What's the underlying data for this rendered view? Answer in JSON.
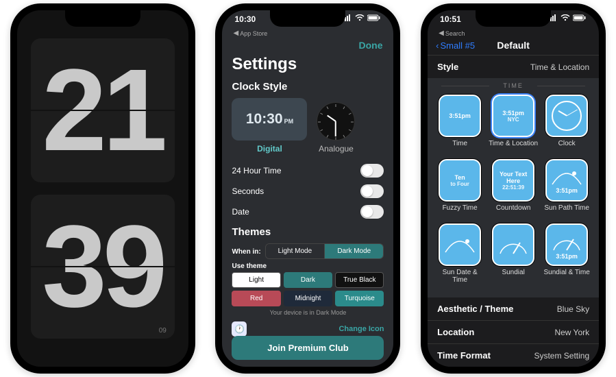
{
  "phone1": {
    "hours": "21",
    "minutes": "39",
    "date": "09"
  },
  "phone2": {
    "status_time": "10:30",
    "breadcrumb": "App Store",
    "done": "Done",
    "title": "Settings",
    "section_clock": "Clock Style",
    "digital": {
      "time": "10:30",
      "suffix": "PM",
      "label": "Digital"
    },
    "analogue_label": "Analogue",
    "toggles": [
      {
        "label": "24 Hour Time",
        "on": false
      },
      {
        "label": "Seconds",
        "on": false
      },
      {
        "label": "Date",
        "on": false
      }
    ],
    "section_themes": "Themes",
    "when_in_label": "When in:",
    "when_in": [
      "Light Mode",
      "Dark Mode"
    ],
    "when_in_active": 1,
    "use_theme_label": "Use theme",
    "themes": [
      "Light",
      "Dark",
      "True Black",
      "Red",
      "Midnight",
      "Turquoise"
    ],
    "theme_hint": "Your device is in Dark Mode",
    "change_icon": "Change Icon",
    "premium": "Join Premium Club"
  },
  "phone3": {
    "status_time": "10:51",
    "breadcrumb": "Search",
    "back": "Small #5",
    "nav_title": "Default",
    "style_label": "Style",
    "style_value": "Time & Location",
    "time_header": "TIME",
    "widgets": [
      {
        "label": "Time",
        "tile_main": "3:51pm"
      },
      {
        "label": "Time & Location",
        "tile_main": "3:51pm",
        "tile_sub": "NYC",
        "selected": true
      },
      {
        "label": "Clock",
        "tile_main": "",
        "clock": true
      },
      {
        "label": "Fuzzy Time",
        "tile_main": "Ten",
        "tile_sub": "to Four"
      },
      {
        "label": "Countdown",
        "tile_main": "Your Text Here",
        "tile_sub": "22:51:39"
      },
      {
        "label": "Sun Path Time",
        "tile_main": "3:51pm",
        "path": true
      },
      {
        "label": "Sun Date & Time",
        "tile_main": "",
        "path": true
      },
      {
        "label": "Sundial",
        "tile_main": "",
        "dial": true
      },
      {
        "label": "Sundial & Time",
        "tile_main": "3:51pm",
        "dial": true
      }
    ],
    "rows": [
      {
        "k": "Aesthetic / Theme",
        "v": "Blue Sky"
      },
      {
        "k": "Location",
        "v": "New York"
      },
      {
        "k": "Time Format",
        "v": "System Setting"
      }
    ]
  }
}
